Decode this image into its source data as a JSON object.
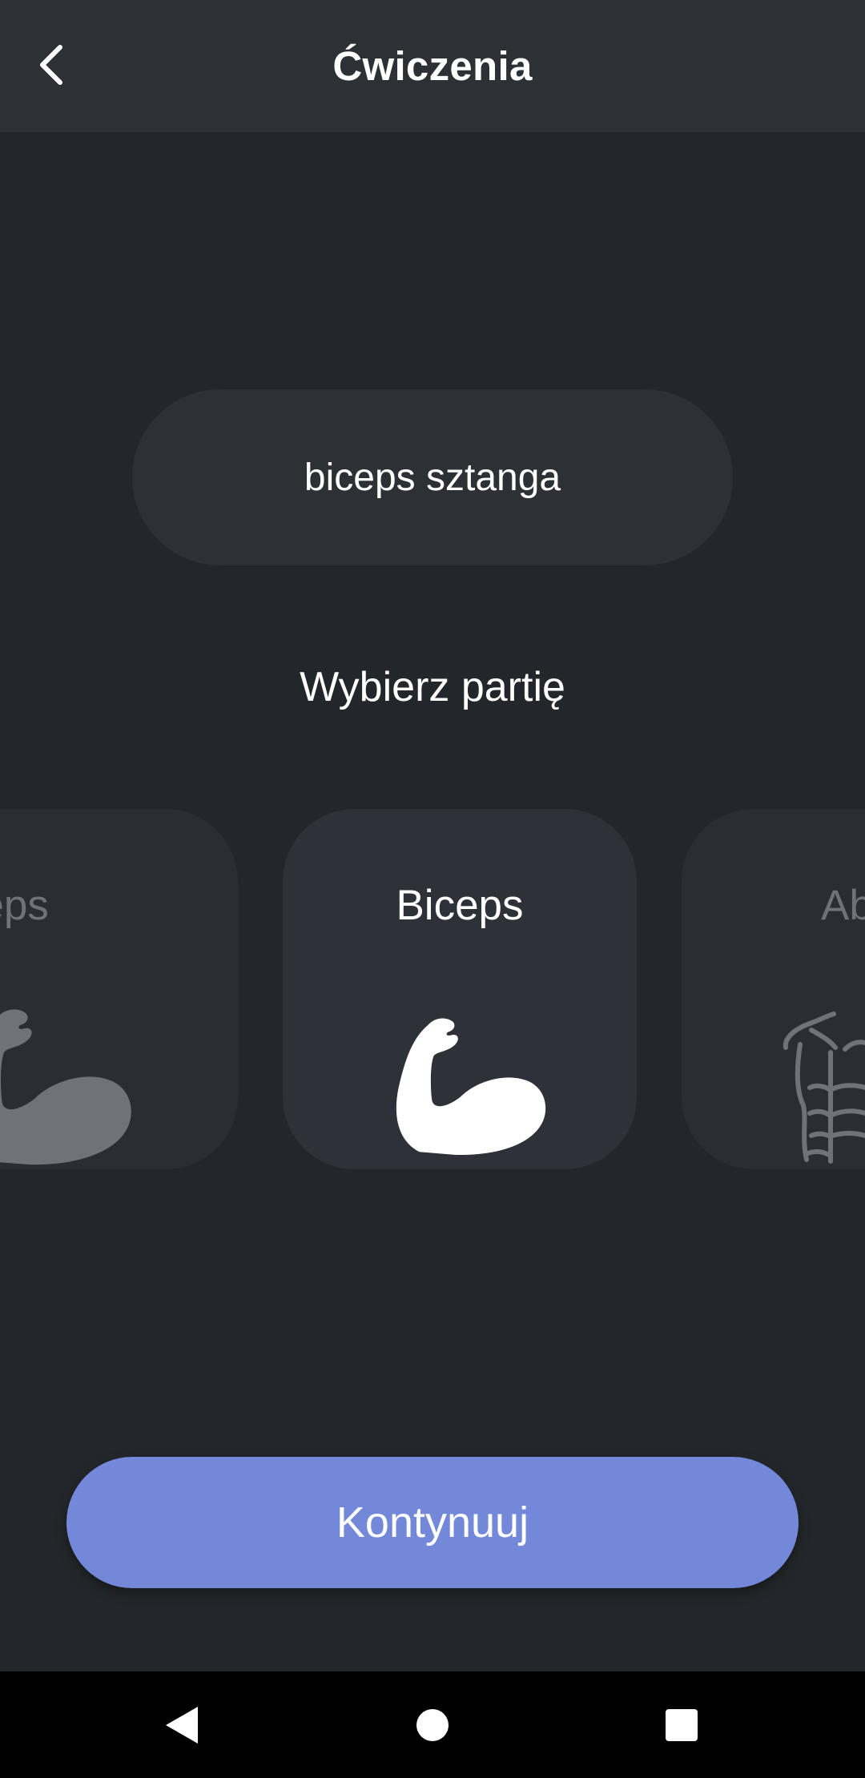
{
  "header": {
    "title": "Ćwiczenia",
    "back_icon": "chevron-left-icon"
  },
  "exercise": {
    "name": "biceps sztanga"
  },
  "section": {
    "label": "Wybierz partię"
  },
  "muscles": [
    {
      "label": "Triceps",
      "icon": "flexed-arm-icon",
      "selected": false
    },
    {
      "label": "Biceps",
      "icon": "flexed-arm-icon",
      "selected": true
    },
    {
      "label": "Ab",
      "icon": "abs-torso-icon",
      "selected": false
    }
  ],
  "actions": {
    "continue_label": "Kontynuuj"
  },
  "colors": {
    "background": "#23262a",
    "surface": "#2d3035",
    "accent": "#7388d9",
    "dim_text": "#6f7276"
  },
  "system_nav": {
    "back_icon": "nav-back-triangle-icon",
    "home_icon": "nav-home-circle-icon",
    "recents_icon": "nav-recents-square-icon"
  }
}
